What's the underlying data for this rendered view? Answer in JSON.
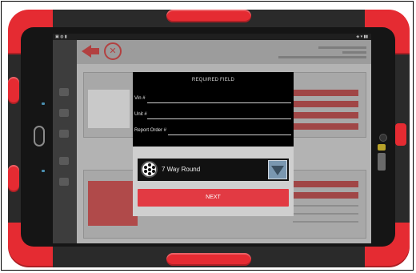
{
  "modal": {
    "title": "REQUIRED FIELD",
    "fields": [
      {
        "label": "Vin #"
      },
      {
        "label": "Unit #"
      },
      {
        "label": "Report Order #"
      }
    ],
    "selector": {
      "icon": "seven-pin-round-connector-icon",
      "value": "7 Way Round"
    },
    "next_button_label": "NEXT"
  },
  "colors": {
    "case_red": "#e52b32",
    "next_button": "#e23a43",
    "dropdown_blue": "#7a97b0"
  }
}
